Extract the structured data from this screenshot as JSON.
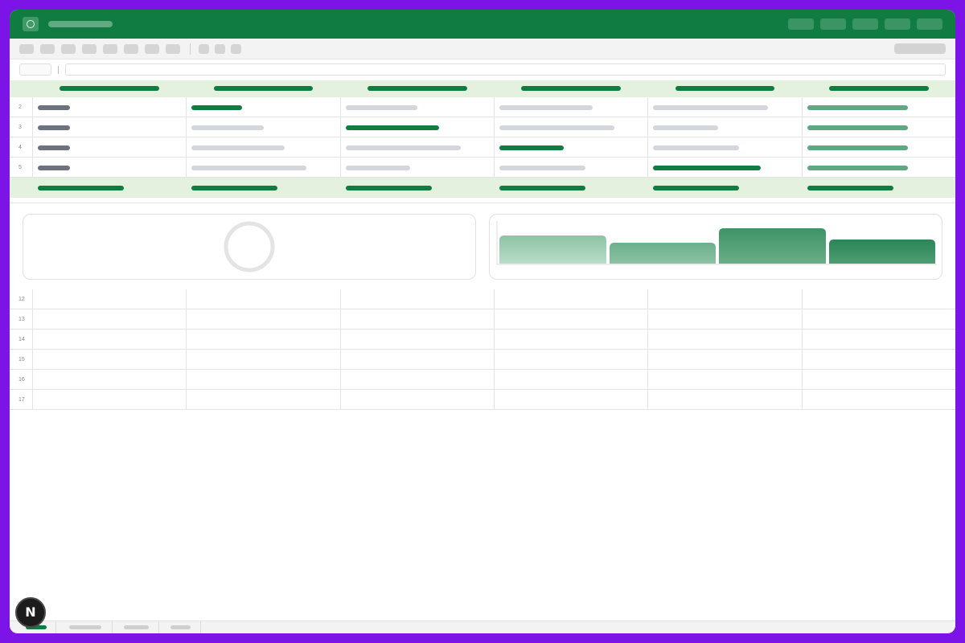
{
  "colors": {
    "frame": "#7c14e8",
    "brand": "#107c41",
    "header_fill": "#e5f1df",
    "accent_mid": "#5fa982",
    "muted_bar": "#d3d6dc",
    "label_bar": "#6c737e"
  },
  "titlebar": {
    "logo_icon": "circle-logo-icon",
    "title": ""
  },
  "grid": {
    "data_row_numbers": [
      "2",
      "3",
      "4",
      "5"
    ],
    "empty_row_numbers": [
      "12",
      "13",
      "14",
      "15",
      "16",
      "17"
    ]
  },
  "floating_badge": {
    "label": "N"
  },
  "sheets": {
    "active_index": 0
  }
}
